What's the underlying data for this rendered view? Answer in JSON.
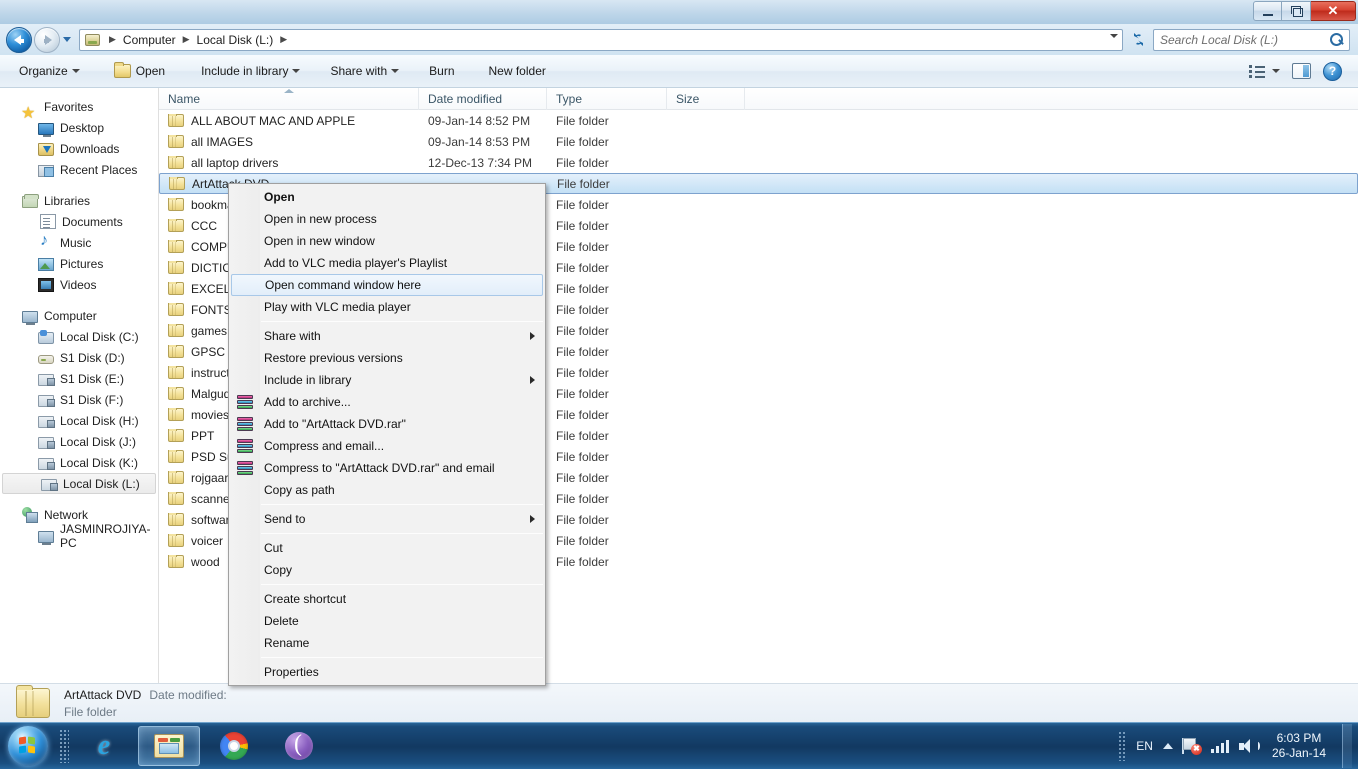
{
  "window": {
    "title": "Local Disk (L:)",
    "min_label": "Minimize",
    "restore_label": "Restore",
    "close_label": "✕"
  },
  "addressbar": {
    "back_label": "Back",
    "forward_label": "Forward",
    "recent_dropdown_label": "Recent pages",
    "drive_icon": "drive-icon",
    "crumbs": [
      "Computer",
      "Local Disk (L:)"
    ],
    "separator": "▶",
    "refresh_label": "↻",
    "search_placeholder": "Search Local Disk (L:)"
  },
  "toolbar": {
    "organize": "Organize",
    "open": "Open",
    "include_in_library": "Include in library",
    "share_with": "Share with",
    "burn": "Burn",
    "new_folder": "New folder",
    "change_view_label": "Change your view",
    "preview_pane_label": "Show the preview pane",
    "help_label": "?"
  },
  "navpane": {
    "groups": [
      {
        "header": {
          "label": "Favorites",
          "icon": "star-icon"
        },
        "items": [
          {
            "label": "Desktop",
            "icon": "desktop-icon"
          },
          {
            "label": "Downloads",
            "icon": "downloads-icon"
          },
          {
            "label": "Recent Places",
            "icon": "recent-places-icon"
          }
        ]
      },
      {
        "header": {
          "label": "Libraries",
          "icon": "libraries-icon"
        },
        "items": [
          {
            "label": "Documents",
            "icon": "documents-icon"
          },
          {
            "label": "Music",
            "icon": "music-icon"
          },
          {
            "label": "Pictures",
            "icon": "pictures-icon"
          },
          {
            "label": "Videos",
            "icon": "videos-icon"
          }
        ]
      },
      {
        "header": {
          "label": "Computer",
          "icon": "computer-icon"
        },
        "items": [
          {
            "label": "Local Disk (C:)",
            "icon": "system-drive-icon",
            "selected": false
          },
          {
            "label": "S1 Disk (D:)",
            "icon": "removable-drive-icon",
            "selected": false
          },
          {
            "label": "S1 Disk (E:)",
            "icon": "network-drive-icon",
            "selected": false
          },
          {
            "label": "S1 Disk (F:)",
            "icon": "network-drive-icon",
            "selected": false
          },
          {
            "label": "Local Disk (H:)",
            "icon": "network-drive-icon",
            "selected": false
          },
          {
            "label": "Local Disk (J:)",
            "icon": "network-drive-icon",
            "selected": false
          },
          {
            "label": "Local Disk (K:)",
            "icon": "network-drive-icon",
            "selected": false
          },
          {
            "label": "Local Disk (L:)",
            "icon": "network-drive-icon",
            "selected": true
          }
        ]
      },
      {
        "header": {
          "label": "Network",
          "icon": "network-icon"
        },
        "items": [
          {
            "label": "JASMINROJIYA-PC",
            "icon": "computer-icon"
          }
        ]
      }
    ]
  },
  "filelist": {
    "columns": [
      {
        "key": "name",
        "label": "Name",
        "sorted": true
      },
      {
        "key": "date",
        "label": "Date modified",
        "sorted": false
      },
      {
        "key": "type",
        "label": "Type",
        "sorted": false
      },
      {
        "key": "size",
        "label": "Size",
        "sorted": false
      }
    ],
    "rows": [
      {
        "name": "ALL ABOUT MAC AND APPLE",
        "date": "09-Jan-14 8:52 PM",
        "type": "File folder",
        "size": "",
        "selected": false
      },
      {
        "name": "all IMAGES",
        "date": "09-Jan-14 8:53 PM",
        "type": "File folder",
        "size": "",
        "selected": false
      },
      {
        "name": "all laptop drivers",
        "date": "12-Dec-13 7:34 PM",
        "type": "File folder",
        "size": "",
        "selected": false
      },
      {
        "name": "ArtAttack DVD",
        "date": "",
        "type": "File folder",
        "size": "",
        "selected": true
      },
      {
        "name": "bookmarks",
        "date": "",
        "type": "File folder",
        "size": "",
        "selected": false
      },
      {
        "name": "CCC",
        "date": "",
        "type": "File folder",
        "size": "",
        "selected": false
      },
      {
        "name": "COMPUTER",
        "date": "",
        "type": "File folder",
        "size": "",
        "selected": false
      },
      {
        "name": "DICTIONARY",
        "date": "",
        "type": "File folder",
        "size": "",
        "selected": false
      },
      {
        "name": "EXCEL",
        "date": "",
        "type": "File folder",
        "size": "",
        "selected": false
      },
      {
        "name": "FONTS",
        "date": "",
        "type": "File folder",
        "size": "",
        "selected": false
      },
      {
        "name": "games",
        "date": "",
        "type": "File folder",
        "size": "",
        "selected": false
      },
      {
        "name": "GPSC",
        "date": "",
        "type": "File folder",
        "size": "",
        "selected": false
      },
      {
        "name": "instructions",
        "date": "",
        "type": "File folder",
        "size": "",
        "selected": false
      },
      {
        "name": "Malgudi",
        "date": "",
        "type": "File folder",
        "size": "",
        "selected": false
      },
      {
        "name": "movies",
        "date": "",
        "type": "File folder",
        "size": "",
        "selected": false
      },
      {
        "name": "PPT",
        "date": "",
        "type": "File folder",
        "size": "",
        "selected": false
      },
      {
        "name": "PSD Subject",
        "date": "",
        "type": "File folder",
        "size": "",
        "selected": false
      },
      {
        "name": "rojgaar",
        "date": "",
        "type": "File folder",
        "size": "",
        "selected": false
      },
      {
        "name": "scanner",
        "date": "",
        "type": "File folder",
        "size": "",
        "selected": false
      },
      {
        "name": "software",
        "date": "",
        "type": "File folder",
        "size": "",
        "selected": false
      },
      {
        "name": "voicer",
        "date": "",
        "type": "File folder",
        "size": "",
        "selected": false
      },
      {
        "name": "wood",
        "date": "",
        "type": "File folder",
        "size": "",
        "selected": false
      }
    ]
  },
  "contextmenu": {
    "items": [
      {
        "label": "Open",
        "bold": true,
        "icon": null,
        "submenu": false,
        "highlighted": false
      },
      {
        "label": "Open in new process",
        "bold": false,
        "icon": null,
        "submenu": false,
        "highlighted": false
      },
      {
        "label": "Open in new window",
        "bold": false,
        "icon": null,
        "submenu": false,
        "highlighted": false
      },
      {
        "label": "Add to VLC media player's Playlist",
        "bold": false,
        "icon": null,
        "submenu": false,
        "highlighted": false
      },
      {
        "label": "Open command window here",
        "bold": false,
        "icon": null,
        "submenu": false,
        "highlighted": true
      },
      {
        "label": "Play with VLC media player",
        "bold": false,
        "icon": null,
        "submenu": false,
        "highlighted": false
      },
      {
        "separator": true
      },
      {
        "label": "Share with",
        "bold": false,
        "icon": null,
        "submenu": true,
        "highlighted": false
      },
      {
        "label": "Restore previous versions",
        "bold": false,
        "icon": null,
        "submenu": false,
        "highlighted": false
      },
      {
        "label": "Include in library",
        "bold": false,
        "icon": null,
        "submenu": true,
        "highlighted": false
      },
      {
        "label": "Add to archive...",
        "bold": false,
        "icon": "winrar-icon",
        "submenu": false,
        "highlighted": false
      },
      {
        "label": "Add to \"ArtAttack DVD.rar\"",
        "bold": false,
        "icon": "winrar-icon",
        "submenu": false,
        "highlighted": false
      },
      {
        "label": "Compress and email...",
        "bold": false,
        "icon": "winrar-icon",
        "submenu": false,
        "highlighted": false
      },
      {
        "label": "Compress to \"ArtAttack DVD.rar\" and email",
        "bold": false,
        "icon": "winrar-icon",
        "submenu": false,
        "highlighted": false
      },
      {
        "label": "Copy as path",
        "bold": false,
        "icon": null,
        "submenu": false,
        "highlighted": false
      },
      {
        "separator": true
      },
      {
        "label": "Send to",
        "bold": false,
        "icon": null,
        "submenu": true,
        "highlighted": false
      },
      {
        "separator": true
      },
      {
        "label": "Cut",
        "bold": false,
        "icon": null,
        "submenu": false,
        "highlighted": false
      },
      {
        "label": "Copy",
        "bold": false,
        "icon": null,
        "submenu": false,
        "highlighted": false
      },
      {
        "separator": true
      },
      {
        "label": "Create shortcut",
        "bold": false,
        "icon": null,
        "submenu": false,
        "highlighted": false
      },
      {
        "label": "Delete",
        "bold": false,
        "icon": null,
        "submenu": false,
        "highlighted": false
      },
      {
        "label": "Rename",
        "bold": false,
        "icon": null,
        "submenu": false,
        "highlighted": false
      },
      {
        "separator": true
      },
      {
        "label": "Properties",
        "bold": false,
        "icon": null,
        "submenu": false,
        "highlighted": false
      }
    ]
  },
  "details": {
    "name": "ArtAttack DVD",
    "meta_label": "Date modified:",
    "type": "File folder"
  },
  "taskbar": {
    "start_label": "Start",
    "tasks": [
      {
        "name": "internet-explorer",
        "glyph": "e",
        "active": false
      },
      {
        "name": "windows-explorer",
        "glyph": "",
        "active": true
      },
      {
        "name": "google-chrome",
        "glyph": "",
        "active": false
      },
      {
        "name": "bittorrent",
        "glyph": "",
        "active": false
      }
    ],
    "tray": {
      "language": "EN",
      "show_hidden_label": "Show hidden icons",
      "network_label": "Network — no connection",
      "signal_label": "Signal strength",
      "volume_label": "Volume",
      "time": "6:03 PM",
      "date": "26-Jan-14"
    }
  },
  "colors": {
    "selection_blue": "#c3e0f5",
    "selection_border": "#7da2ce",
    "menu_highlight": "#e2eefa",
    "close_red": "#d64231",
    "taskbar_blue": "#0e2d52"
  }
}
